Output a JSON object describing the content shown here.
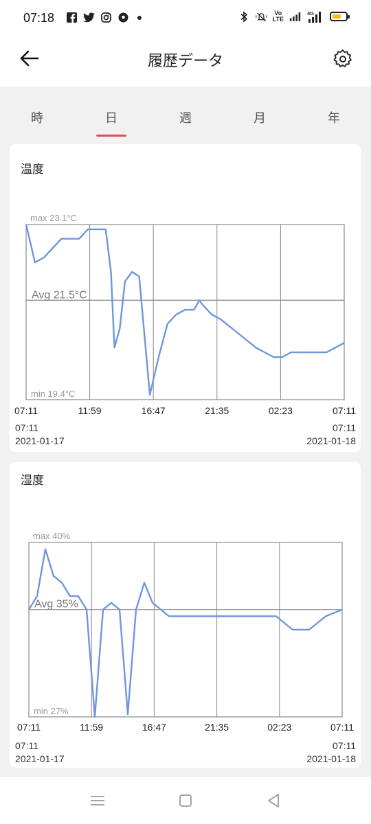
{
  "status_bar": {
    "time": "07:18",
    "volte_top": "Vo",
    "volte_bottom": "LTE",
    "signal_label": "4G"
  },
  "header": {
    "title": "履歴データ"
  },
  "tabs": [
    {
      "label": "時",
      "active": false
    },
    {
      "label": "日",
      "active": true
    },
    {
      "label": "週",
      "active": false
    },
    {
      "label": "月",
      "active": false
    },
    {
      "label": "年",
      "active": false
    }
  ],
  "colors": {
    "accent": "#e05050",
    "line": "#6f96dc",
    "grid": "#888888"
  },
  "charts": [
    {
      "title": "温度",
      "max_label": "max 23.1°C",
      "avg_label": "Avg 21.5°C",
      "min_label": "min 19.4°C",
      "x_ticks": [
        "07:11",
        "11:59",
        "16:47",
        "21:35",
        "02:23",
        "07:11"
      ],
      "start_time": "07:11",
      "start_date": "2021-01-17",
      "end_time": "07:11",
      "end_date": "2021-01-18"
    },
    {
      "title": "湿度",
      "max_label": "max 40%",
      "avg_label": "Avg 35%",
      "min_label": "min 27%",
      "x_ticks": [
        "07:11",
        "11:59",
        "16:47",
        "21:35",
        "02:23",
        "07:11"
      ],
      "start_time": "07:11",
      "start_date": "2021-01-17",
      "end_time": "07:11",
      "end_date": "2021-01-18"
    }
  ],
  "chart_data": [
    {
      "type": "line",
      "title": "温度",
      "categories": [
        "07:11",
        "11:59",
        "16:47",
        "21:35",
        "02:23",
        "07:11"
      ],
      "x_hours": [
        0,
        0.5,
        1,
        1.5,
        2,
        2.5,
        3,
        3.5,
        4,
        4.5,
        4.8,
        5,
        5.3,
        5.6,
        6,
        6.4,
        7,
        7.5,
        8,
        8.5,
        9,
        9.5,
        9.8,
        10,
        10.5,
        11,
        12,
        13,
        14,
        14.5,
        15,
        16,
        17,
        18,
        19,
        20,
        21,
        22,
        23,
        24
      ],
      "series": [
        {
          "values": [
            23.1,
            22.3,
            22.4,
            22.6,
            22.8,
            22.8,
            22.8,
            23.0,
            23.0,
            23.0,
            22.1,
            20.5,
            20.9,
            21.9,
            22.1,
            22.0,
            19.5,
            20.3,
            21.0,
            21.2,
            21.3,
            21.3,
            21.5,
            21.4,
            21.2,
            21.1,
            20.8,
            20.5,
            20.3,
            20.3,
            20.4,
            20.4,
            20.4,
            20.6
          ]
        }
      ],
      "ylim": [
        19.4,
        23.1
      ],
      "avg": 21.5,
      "grid": true
    },
    {
      "type": "line",
      "title": "湿度",
      "categories": [
        "07:11",
        "11:59",
        "16:47",
        "21:35",
        "02:23",
        "07:11"
      ],
      "x_hours": [
        0,
        0.5,
        1,
        1.5,
        2,
        2.5,
        3,
        3.5,
        4,
        4.5,
        5,
        5.5,
        6,
        6.5,
        7,
        7.5,
        8,
        8.5,
        9,
        9.5,
        10,
        10.5,
        11,
        12,
        13,
        14,
        15,
        16,
        17,
        18,
        19,
        20,
        21,
        22,
        23,
        24
      ],
      "series": [
        {
          "values": [
            35,
            36,
            39.5,
            37.5,
            37,
            36,
            36,
            35,
            27,
            35,
            35.5,
            35,
            27.2,
            35,
            37,
            35.5,
            35,
            34.5,
            34.5,
            34.5,
            34.5,
            34.5,
            34.5,
            34.5,
            34.5,
            34.5,
            34.5,
            33.5,
            33.5,
            34.5,
            35
          ]
        }
      ],
      "ylim": [
        27,
        40
      ],
      "avg": 35,
      "grid": true
    }
  ]
}
